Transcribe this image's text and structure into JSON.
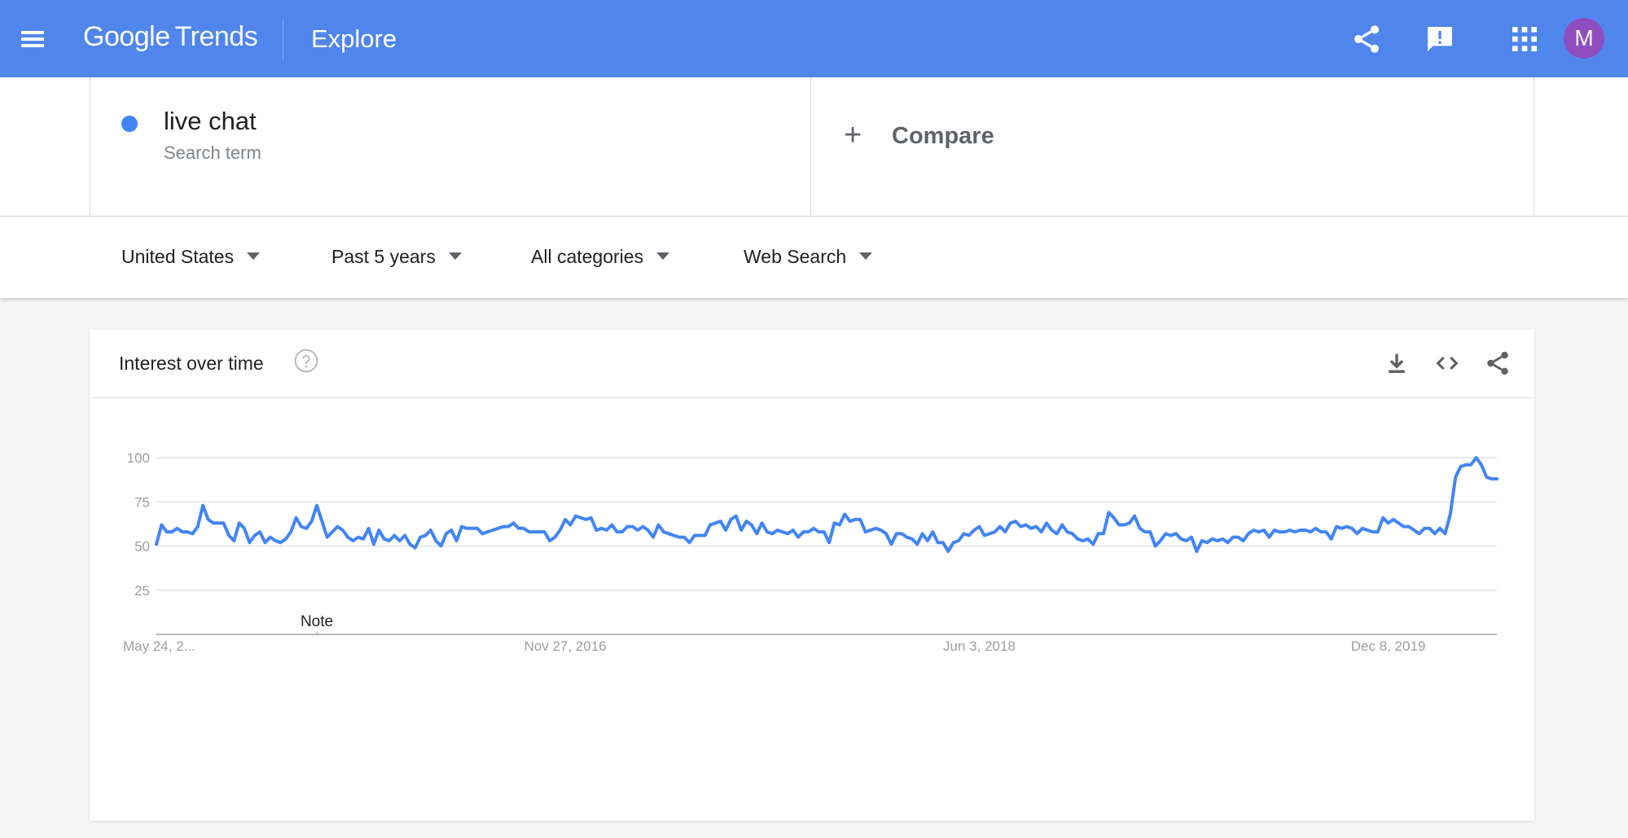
{
  "header": {
    "logo_google": "Google",
    "logo_trends": "Trends",
    "title": "Explore",
    "avatar_letter": "M",
    "icons": [
      "menu-icon",
      "share-icon",
      "feedback-icon",
      "apps-icon"
    ],
    "color": "#5086ec"
  },
  "search_term": {
    "term": "live chat",
    "subtitle": "Search term",
    "color": "#4285f4"
  },
  "compare": {
    "label": "Compare"
  },
  "filters": {
    "region": "United States",
    "time": "Past 5 years",
    "category": "All categories",
    "property": "Web Search"
  },
  "card": {
    "title": "Interest over time",
    "icons": [
      "help-icon",
      "download-icon",
      "embed-icon",
      "share-icon"
    ]
  },
  "chart_data": {
    "type": "line",
    "title": "",
    "xlabel": "",
    "ylabel": "",
    "ylim": [
      0,
      100
    ],
    "yticks": [
      25,
      50,
      75,
      100
    ],
    "xtick_labels": [
      "May 24, 2...",
      "Nov 27, 2016",
      "Jun 3, 2018",
      "Dec 8, 2019"
    ],
    "annotation": "Note",
    "grid": true,
    "series": [
      {
        "color": "#4285f4",
        "values": [
          51,
          62,
          58,
          58,
          60,
          58,
          58,
          57,
          61,
          73,
          65,
          63,
          63,
          63,
          56,
          53,
          63,
          60,
          52,
          56,
          58,
          52,
          55,
          53,
          52,
          54,
          58,
          66,
          61,
          60,
          64,
          73,
          64,
          55,
          58,
          61,
          59,
          55,
          53,
          55,
          54,
          60,
          51,
          59,
          54,
          53,
          56,
          53,
          56,
          51,
          49,
          55,
          56,
          59,
          53,
          50,
          57,
          59,
          53,
          61,
          60,
          60,
          60,
          57,
          58,
          59,
          60,
          61,
          61,
          63,
          60,
          60,
          58,
          58,
          58,
          58,
          53,
          55,
          59,
          65,
          62,
          67,
          66,
          65,
          66,
          59,
          60,
          59,
          62,
          58,
          58,
          61,
          61,
          59,
          61,
          59,
          55,
          62,
          58,
          57,
          56,
          55,
          55,
          52,
          56,
          56,
          56,
          62,
          63,
          64,
          59,
          65,
          67,
          59,
          64,
          62,
          57,
          63,
          58,
          57,
          59,
          58,
          57,
          59,
          55,
          58,
          58,
          60,
          58,
          58,
          52,
          63,
          62,
          68,
          64,
          65,
          65,
          58,
          59,
          60,
          59,
          57,
          51,
          57,
          57,
          55,
          54,
          51,
          57,
          53,
          58,
          52,
          52,
          47,
          52,
          53,
          57,
          56,
          59,
          61,
          56,
          57,
          58,
          61,
          58,
          63,
          64,
          61,
          62,
          60,
          61,
          58,
          63,
          59,
          57,
          62,
          58,
          57,
          54,
          53,
          54,
          51,
          57,
          57,
          69,
          66,
          62,
          62,
          63,
          67,
          60,
          58,
          58,
          50,
          53,
          57,
          56,
          57,
          54,
          53,
          55,
          47,
          53,
          52,
          54,
          53,
          54,
          52,
          55,
          55,
          53,
          57,
          59,
          58,
          59,
          55,
          59,
          58,
          58,
          59,
          58,
          59,
          59,
          58,
          60,
          58,
          58,
          54,
          61,
          60,
          61,
          60,
          57,
          60,
          59,
          58,
          58,
          66,
          63,
          65,
          63,
          61,
          61,
          59,
          57,
          60,
          60,
          57,
          60,
          57,
          68,
          89,
          95,
          96,
          96,
          100,
          96,
          89,
          88,
          88
        ]
      }
    ]
  }
}
